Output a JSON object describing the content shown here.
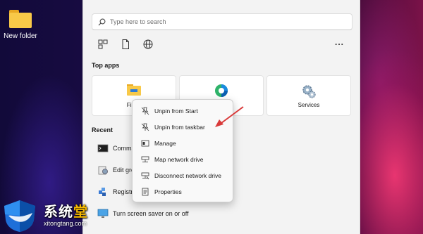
{
  "desktop": {
    "icons": [
      {
        "label": "New folder",
        "icon": "folder-icon"
      }
    ]
  },
  "start_menu": {
    "search": {
      "placeholder": "Type here to search"
    },
    "quick_icons": [
      "apps-icon",
      "document-icon",
      "globe-icon"
    ],
    "more_label": "...",
    "top_apps": {
      "title": "Top apps",
      "tiles": [
        {
          "label": "File E",
          "icon": "file-explorer-icon"
        },
        {
          "label": "",
          "icon": "edge-icon"
        },
        {
          "label": "Services",
          "icon": "services-icon"
        }
      ]
    },
    "recent": {
      "title": "Recent",
      "items": [
        {
          "label": "Comma",
          "icon": "command-prompt-icon"
        },
        {
          "label": "Edit gro",
          "icon": "group-policy-icon"
        },
        {
          "label": "Registry",
          "icon": "registry-icon"
        },
        {
          "label": "Turn screen saver on or off",
          "icon": "screen-saver-icon"
        }
      ]
    }
  },
  "context_menu": {
    "items": [
      {
        "label": "Unpin from Start",
        "icon": "unpin-icon"
      },
      {
        "label": "Unpin from taskbar",
        "icon": "unpin-icon"
      },
      {
        "label": "Manage",
        "icon": "manage-icon"
      },
      {
        "label": "Map network drive",
        "icon": "map-drive-icon"
      },
      {
        "label": "Disconnect network drive",
        "icon": "disconnect-drive-icon"
      },
      {
        "label": "Properties",
        "icon": "properties-icon"
      }
    ]
  },
  "annotation": {
    "color": "#d93a3a",
    "points_to": "Unpin from taskbar"
  },
  "watermark": {
    "brand": "系统堂",
    "brand_main": "系统",
    "brand_accent": "堂",
    "url": "xitongtang.com"
  }
}
